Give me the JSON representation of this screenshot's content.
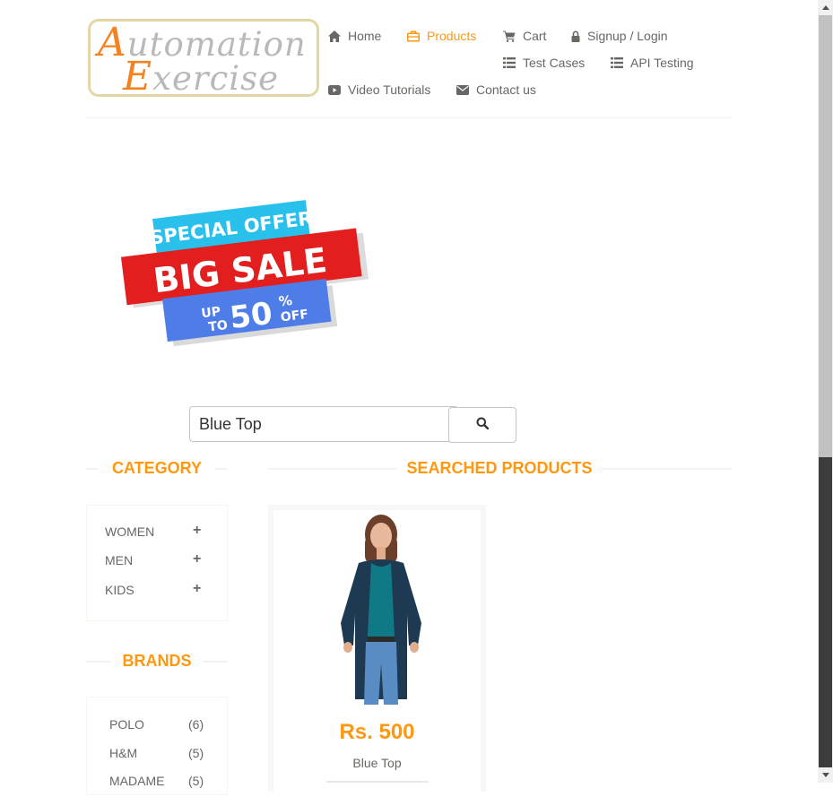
{
  "logo": {
    "line1_initial": "A",
    "line1_rest": "utomation",
    "line2_initial": "E",
    "line2_rest": "xercise"
  },
  "nav": {
    "home": "Home",
    "products": "Products",
    "cart": "Cart",
    "signup_login": "Signup / Login",
    "test_cases": "Test Cases",
    "api_testing": "API Testing",
    "video_tutorials": "Video Tutorials",
    "contact_us": "Contact us"
  },
  "banner": {
    "special_offer": "SPECIAL OFFER",
    "big_sale": "BIG SALE",
    "up": "UP",
    "to": "TO",
    "percent_value": "50",
    "percent_sign": "%",
    "off": "OFF"
  },
  "search": {
    "value": "Blue Top",
    "icon": "search-icon"
  },
  "sidebar": {
    "category_title": "CATEGORY",
    "categories": [
      {
        "label": "WOMEN",
        "toggle": "+"
      },
      {
        "label": "MEN",
        "toggle": "+"
      },
      {
        "label": "KIDS",
        "toggle": "+"
      }
    ],
    "brands_title": "BRANDS",
    "brands": [
      {
        "name": "POLO",
        "count": "(6)"
      },
      {
        "name": "H&M",
        "count": "(5)"
      },
      {
        "name": "MADAME",
        "count": "(5)"
      }
    ]
  },
  "main": {
    "title": "SEARCHED PRODUCTS",
    "products": [
      {
        "price": "Rs. 500",
        "name": "Blue Top"
      }
    ]
  },
  "colors": {
    "accent": "#fe980f",
    "text": "#696763",
    "logo_orange": "#f58220",
    "logo_grey": "#b9b9b9",
    "banner_cyan": "#29c0ec",
    "banner_red": "#e21e1e",
    "banner_blue": "#4f7de8"
  }
}
